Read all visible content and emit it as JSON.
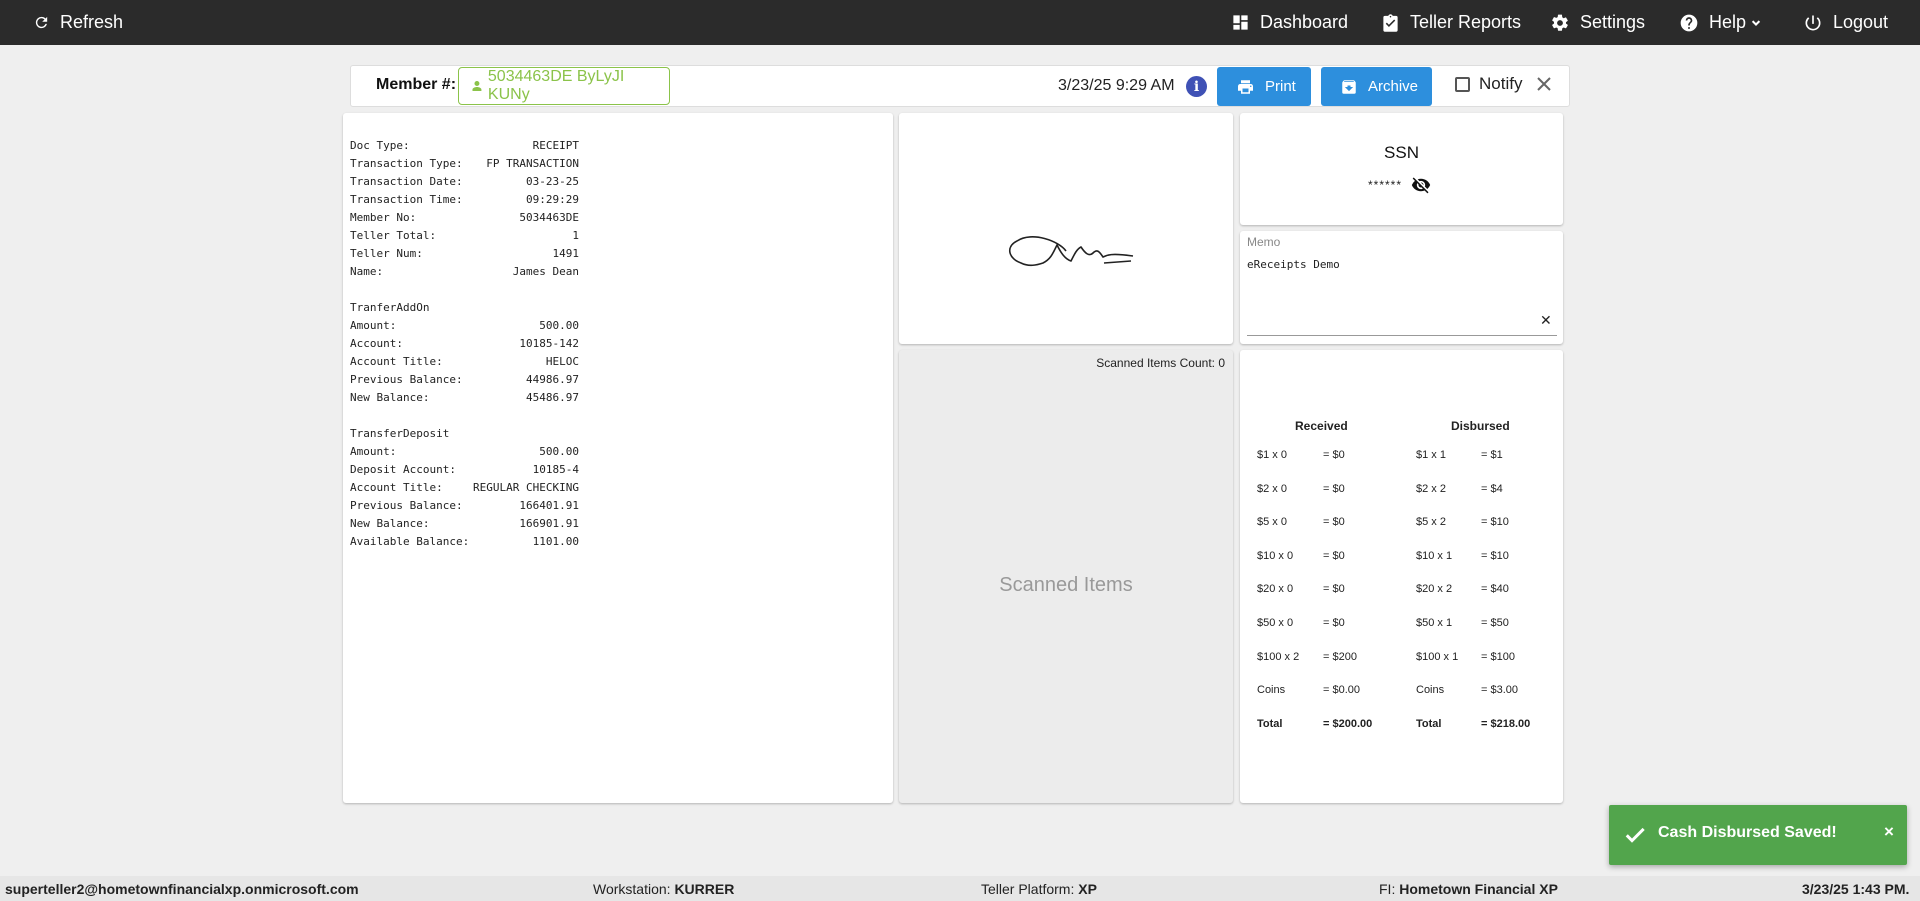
{
  "nav": {
    "refresh": "Refresh",
    "dashboard": "Dashboard",
    "teller_reports": "Teller Reports",
    "settings": "Settings",
    "help": "Help",
    "logout": "Logout"
  },
  "member_bar": {
    "label": "Member #:",
    "member": "5034463DE ByLyJI KUNy",
    "datetime": "3/23/25 9:29 AM",
    "info": "i",
    "print": "Print",
    "archive": "Archive",
    "notify": "Notify",
    "notify_checked": false
  },
  "receipt": {
    "lines": [
      {
        "k": "Doc Type:",
        "v": "RECEIPT"
      },
      {
        "k": "Transaction Type:",
        "v": "FP TRANSACTION"
      },
      {
        "k": "Transaction Date:",
        "v": "03-23-25"
      },
      {
        "k": "Transaction Time:",
        "v": "09:29:29"
      },
      {
        "k": "Member No:",
        "v": "5034463DE"
      },
      {
        "k": "Teller Total:",
        "v": "1"
      },
      {
        "k": "Teller Num:",
        "v": "1491"
      },
      {
        "k": "Name:",
        "v": "James Dean"
      },
      {
        "k": "",
        "v": ""
      },
      {
        "k": "TranferAddOn",
        "v": ""
      },
      {
        "k": "Amount:",
        "v": "500.00"
      },
      {
        "k": "Account:",
        "v": "10185-142"
      },
      {
        "k": "Account Title:",
        "v": "HELOC"
      },
      {
        "k": "Previous Balance:",
        "v": "44986.97"
      },
      {
        "k": "New Balance:",
        "v": "45486.97"
      },
      {
        "k": "",
        "v": ""
      },
      {
        "k": "TransferDeposit",
        "v": ""
      },
      {
        "k": "Amount:",
        "v": "500.00"
      },
      {
        "k": "Deposit Account:",
        "v": "10185-4"
      },
      {
        "k": "Account Title:",
        "v": "REGULAR CHECKING"
      },
      {
        "k": "Previous Balance:",
        "v": "166401.91"
      },
      {
        "k": "New Balance:",
        "v": "166901.91"
      },
      {
        "k": "Available Balance:",
        "v": "1101.00"
      }
    ]
  },
  "scanned": {
    "count_label": "Scanned Items Count: 0",
    "placeholder": "Scanned Items"
  },
  "ssn": {
    "title": "SSN",
    "masked": "******"
  },
  "memo": {
    "label": "Memo",
    "text": "eReceipts Demo",
    "clear": "✕"
  },
  "cash": {
    "received_header": "Received",
    "disbursed_header": "Disbursed",
    "received": [
      {
        "denom": "$1 x 0",
        "amt": "= $0"
      },
      {
        "denom": "$2 x 0",
        "amt": "= $0"
      },
      {
        "denom": "$5 x 0",
        "amt": "= $0"
      },
      {
        "denom": "$10 x 0",
        "amt": "= $0"
      },
      {
        "denom": "$20 x 0",
        "amt": "= $0"
      },
      {
        "denom": "$50 x 0",
        "amt": "= $0"
      },
      {
        "denom": "$100 x 2",
        "amt": "= $200"
      },
      {
        "denom": "Coins",
        "amt": "= $0.00"
      },
      {
        "denom": "Total",
        "amt": "= $200.00"
      }
    ],
    "disbursed": [
      {
        "denom": "$1 x 1",
        "amt": "= $1"
      },
      {
        "denom": "$2 x 2",
        "amt": "= $4"
      },
      {
        "denom": "$5 x 2",
        "amt": "= $10"
      },
      {
        "denom": "$10 x 1",
        "amt": "= $10"
      },
      {
        "denom": "$20 x 2",
        "amt": "= $40"
      },
      {
        "denom": "$50 x 1",
        "amt": "= $50"
      },
      {
        "denom": "$100 x 1",
        "amt": "= $100"
      },
      {
        "denom": "Coins",
        "amt": "= $3.00"
      },
      {
        "denom": "Total",
        "amt": "= $218.00"
      }
    ]
  },
  "toast": {
    "message": "Cash Disbursed Saved!",
    "close": "×"
  },
  "footer": {
    "user": "superteller2@hometownfinancialxp.onmicrosoft.com",
    "workstation_label": "Workstation:",
    "workstation": "KURRER",
    "platform_label": "Teller Platform:",
    "platform": "XP",
    "fi_label": "FI:",
    "fi": "Hometown Financial XP",
    "datetime": "3/23/25 1:43 PM."
  },
  "colors": {
    "topbar": "#2b2b2b",
    "accent_blue": "#2d8fdd",
    "member_green": "#8bc34a",
    "toast_green": "#52a54c",
    "info_blue": "#3f51b5"
  }
}
